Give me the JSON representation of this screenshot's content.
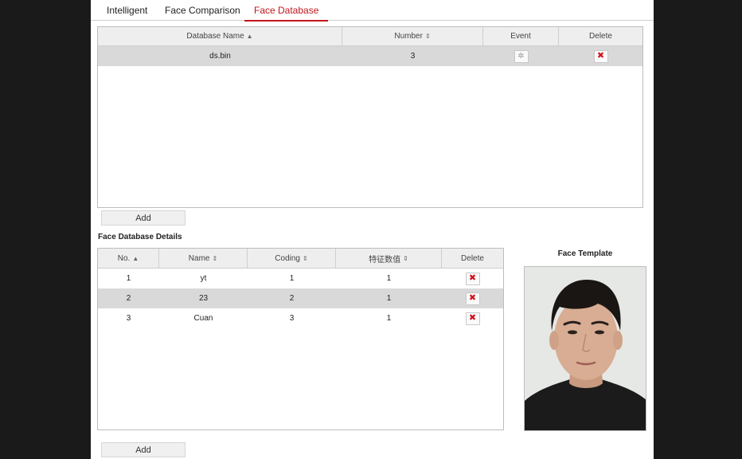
{
  "tabs": [
    {
      "label": "Intelligent"
    },
    {
      "label": "Face Comparison"
    },
    {
      "label": "Face Database"
    }
  ],
  "database_table": {
    "columns": [
      {
        "label": "Database Name",
        "sort": "▲"
      },
      {
        "label": "Number",
        "sort": "⇕"
      },
      {
        "label": "Event",
        "sort": ""
      },
      {
        "label": "Delete",
        "sort": ""
      }
    ],
    "rows": [
      {
        "name": "ds.bin",
        "number": "3"
      }
    ]
  },
  "database_add_label": "Add",
  "details": {
    "title": "Face Database Details",
    "columns": [
      {
        "label": "No.",
        "sort": "▲"
      },
      {
        "label": "Name",
        "sort": "⇕"
      },
      {
        "label": "Coding",
        "sort": "⇕"
      },
      {
        "label": "特征数值",
        "sort": "⇕"
      },
      {
        "label": "Delete",
        "sort": ""
      }
    ],
    "rows": [
      {
        "no": "1",
        "name": "yt",
        "coding": "1",
        "value": "1"
      },
      {
        "no": "2",
        "name": "23",
        "coding": "2",
        "value": "1"
      },
      {
        "no": "3",
        "name": "Cuan",
        "coding": "3",
        "value": "1"
      }
    ],
    "selected_row": 1
  },
  "details_add_label": "Add",
  "face_template": {
    "label": "Face Template"
  },
  "icons": {
    "delete": "close-icon",
    "event": "gear-icon"
  },
  "colors": {
    "accent": "#c0161c",
    "delete_icon": "#d0141c",
    "selected_row": "#d9d9d9"
  }
}
